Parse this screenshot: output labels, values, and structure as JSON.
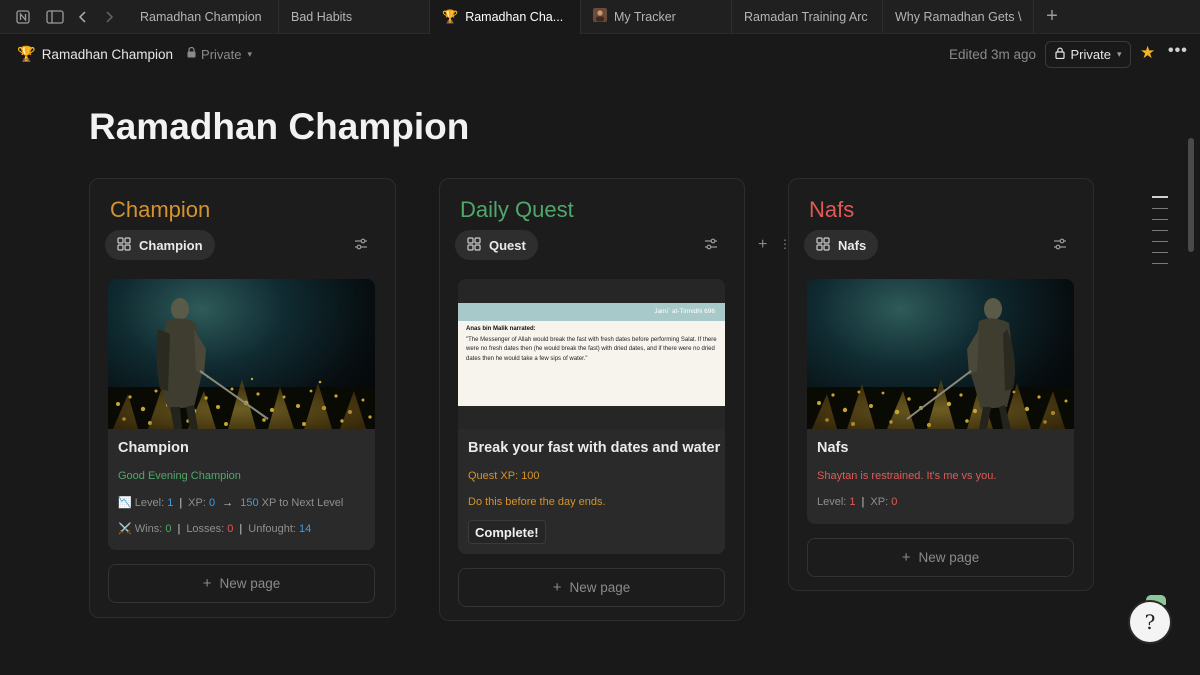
{
  "tabs": [
    {
      "label": "Ramadhan Champion",
      "icon": "",
      "active": false
    },
    {
      "label": "Bad Habits",
      "icon": "",
      "active": false
    },
    {
      "label": "Ramadhan Cha...",
      "icon": "🏆",
      "active": true
    },
    {
      "label": "My Tracker",
      "icon": "avatar",
      "active": false
    },
    {
      "label": "Ramadan Training Arc",
      "icon": "",
      "active": false
    },
    {
      "label": "Why Ramadhan Gets \\",
      "icon": "",
      "active": false
    }
  ],
  "breadcrumb": {
    "title": "Ramadhan Champion",
    "privacy": "Private"
  },
  "topbar": {
    "edited": "Edited 3m ago",
    "privacy_button": "Private"
  },
  "page": {
    "title": "Ramadhan Champion"
  },
  "columns": {
    "champion": {
      "title": "Champion",
      "title_color": "#d4932b",
      "view_label": "Champion",
      "card": {
        "title": "Champion",
        "greeting": "Good Evening Champion",
        "level_label": "Level:",
        "level_value": "1",
        "xp_label": "XP:",
        "xp_value": "0",
        "xp_arrow": "→",
        "xp_next_value": "150",
        "xp_next_label": "XP to Next Level",
        "wins_label": "Wins:",
        "wins_value": "0",
        "losses_label": "Losses:",
        "losses_value": "0",
        "unfought_label": "Unfought:",
        "unfought_value": "14"
      },
      "new_page": "New page"
    },
    "daily_quest": {
      "title": "Daily Quest",
      "title_color": "#4fa86a",
      "view_label": "Quest",
      "card": {
        "hadith_source": "Jami` at-Tirmidhi 696",
        "hadith_narrator": "Anas bin Malik narrated:",
        "hadith_text": "\"The Messenger of Allah would break the fast with fresh dates before performing Salat. If there were no fresh dates then (he would break the fast) with dried dates, and if there were no dried dates then he would take a few sips of water.\"",
        "title": "Break your fast with dates and water",
        "xp": "Quest XP: 100",
        "note": "Do this before the day ends.",
        "button": "Complete!"
      },
      "new_page": "New page"
    },
    "nafs": {
      "title": "Nafs",
      "title_color": "#e05a55",
      "view_label": "Nafs",
      "card": {
        "title": "Nafs",
        "message": "Shaytan is restrained. It's me vs you.",
        "level_label": "Level:",
        "level_value": "1",
        "xp_label": "XP:",
        "xp_value": "0"
      },
      "new_page": "New page"
    }
  },
  "icons": {
    "notion": "notion-icon",
    "sidebar": "sidebar-toggle-icon",
    "back": "back-arrow-icon",
    "forward": "forward-arrow-icon",
    "new_tab": "plus-icon",
    "trophy": "trophy-icon",
    "lock": "lock-icon",
    "star": "star-icon",
    "more": "more-icon",
    "grid": "gallery-grid-icon",
    "filter": "filter-sliders-icon",
    "chart": "chart-icon",
    "swords": "swords-icon"
  }
}
